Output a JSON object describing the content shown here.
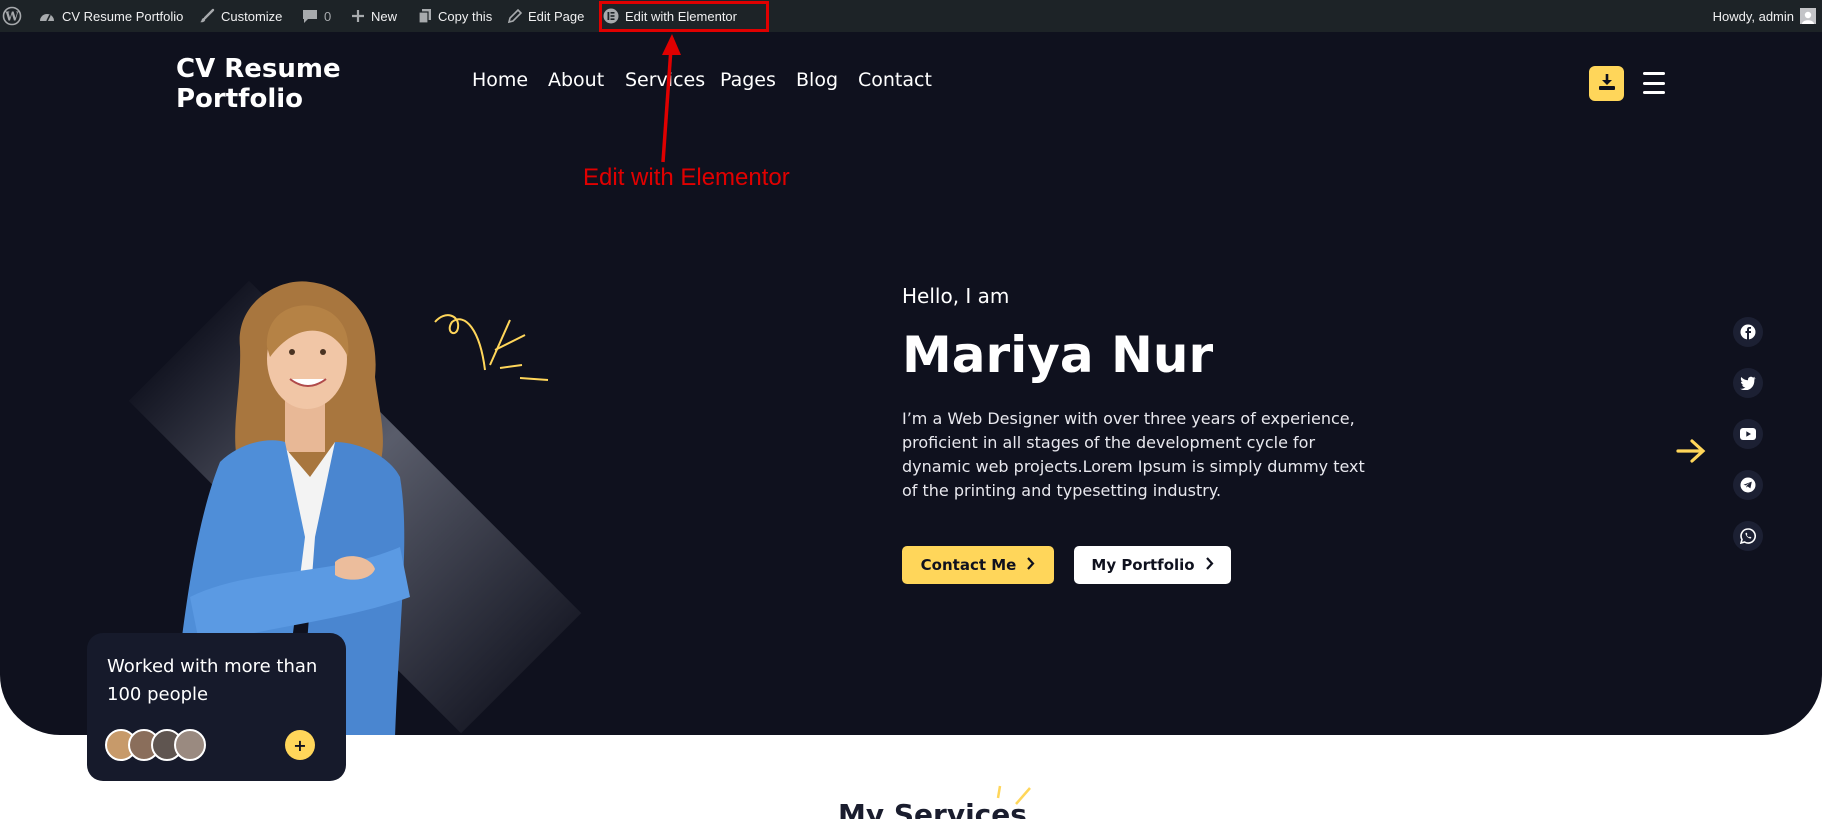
{
  "adminbar": {
    "site_name": "CV Resume Portfolio",
    "customize": "Customize",
    "comments_count": "0",
    "new": "New",
    "copy": "Copy this",
    "edit_page": "Edit Page",
    "edit_elementor": "Edit with Elementor",
    "howdy": "Howdy, admin"
  },
  "annotation": {
    "text": "Edit with Elementor",
    "color": "#e00000"
  },
  "site": {
    "title": "CV Resume Portfolio"
  },
  "nav": [
    "Home",
    "About",
    "Services",
    "Pages",
    "Blog",
    "Contact"
  ],
  "hero": {
    "greeting": "Hello, I am",
    "name": "Mariya Nur",
    "bio": "I’m a Web Designer with over three years of experience, proficient in all stages of the development cycle for dynamic web projects.Lorem Ipsum is simply dummy text of the printing and typesetting industry.",
    "contact_button": "Contact Me",
    "portfolio_button": "My Portfolio"
  },
  "social": [
    "facebook-icon",
    "twitter-icon",
    "youtube-icon",
    "telegram-icon",
    "whatsapp-icon"
  ],
  "stats": {
    "text": "Worked with more than 100 people",
    "more_symbol": "+"
  },
  "services": {
    "title": "My Services"
  },
  "colors": {
    "accent": "#ffd65a",
    "hero_bg": "#0f111e",
    "card_bg": "#161a2b",
    "adminbar_bg": "#1d2327"
  }
}
